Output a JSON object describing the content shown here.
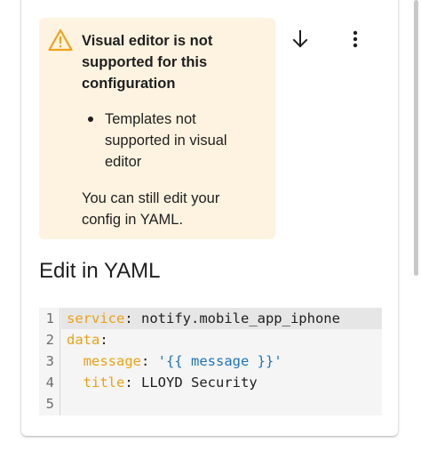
{
  "warning": {
    "icon": "warning-triangle-icon",
    "title": "Visual editor is not supported for this configuration",
    "bullets": [
      "Templates not supported in visual editor"
    ],
    "body": "You can still edit your config in YAML."
  },
  "toolbar": {
    "down_icon": "arrow-down-icon",
    "more_icon": "more-vert-icon"
  },
  "yaml_section": {
    "title": "Edit in YAML"
  },
  "editor": {
    "lines": [
      {
        "num": "1",
        "key": "service",
        "sep": ": ",
        "value": "notify.mobile_app_iphone",
        "indent": ""
      },
      {
        "num": "2",
        "key": "data",
        "sep": ":",
        "value": "",
        "indent": ""
      },
      {
        "num": "3",
        "key": "message",
        "sep": ": ",
        "value": "'{{ message }}'",
        "indent": "  "
      },
      {
        "num": "4",
        "key": "title",
        "sep": ": ",
        "value": "LLOYD Security",
        "indent": "  "
      },
      {
        "num": "5",
        "key": "",
        "sep": "",
        "value": "",
        "indent": ""
      }
    ]
  },
  "colors": {
    "warning_bg": "#fdf3e0",
    "warning_icon": "#f0a21b",
    "yaml_key": "#e8a317",
    "yaml_string": "#1f73b7"
  }
}
